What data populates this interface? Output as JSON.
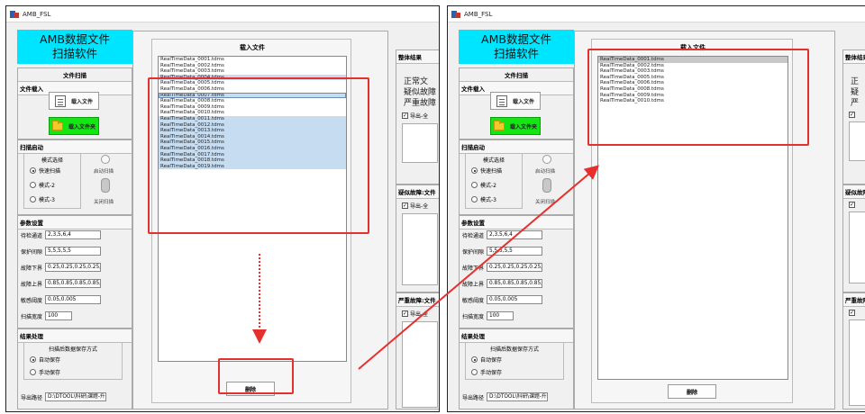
{
  "app": {
    "title": "AMB_FSL",
    "brand_line1": "AMB数据文件",
    "brand_line2": "扫描软件"
  },
  "file_scan": {
    "title": "文件扫描",
    "load_section": "文件载入",
    "load_file_button": "载入文件",
    "load_folder_button": "载入文件夹"
  },
  "scan_start": {
    "section": "扫描启动",
    "mode_group_title": "模式选择",
    "modes": [
      "快速扫描",
      "模式-2",
      "模式-3"
    ],
    "auto_label": "启动扫描",
    "stop_label": "关闭扫描"
  },
  "params": {
    "section": "参数设置",
    "rows": [
      {
        "label": "待检通道",
        "value": "2,3,5,6,4"
      },
      {
        "label": "保护间隙",
        "value": "5,5,5,5,5"
      },
      {
        "label": "故障下界",
        "value": "0.25,0.25,0.25,0.25,0.25"
      },
      {
        "label": "故障上界",
        "value": "0.85,0.85,0.85,0.85,0.85"
      },
      {
        "label": "敏感阈度",
        "value": "0.05,0.005"
      },
      {
        "label": "扫描宽度",
        "value": "100"
      }
    ]
  },
  "result_proc": {
    "section": "结果处理",
    "save_group_title": "扫描后数据保存方式",
    "save_modes": [
      "自动保存",
      "手动保存"
    ],
    "export_label": "导出路径",
    "export_path": "D:\\DTOOL\\科研\\课题-升"
  },
  "load_frame": {
    "title": "载入文件",
    "delete_button": "删除",
    "files_before": [
      "RealTimeData_0001.tdms",
      "RealTimeData_0002.tdms",
      "RealTimeData_0003.tdms",
      "RealTimeData_0004.tdms",
      "RealTimeData_0005.tdms",
      "RealTimeData_0006.tdms",
      "RealTimeData_0007.tdms",
      "RealTimeData_0008.tdms",
      "RealTimeData_0009.tdms",
      "RealTimeData_0010.tdms",
      "RealTimeData_0011.tdms",
      "RealTimeData_0012.tdms",
      "RealTimeData_0013.tdms",
      "RealTimeData_0014.tdms",
      "RealTimeData_0015.tdms",
      "RealTimeData_0016.tdms",
      "RealTimeData_0017.tdms",
      "RealTimeData_0018.tdms",
      "RealTimeData_0019.tdms"
    ],
    "files_after": [
      "RealTimeData_0001.tdms",
      "RealTimeData_0002.tdms",
      "RealTimeData_0003.tdms",
      "RealTimeData_0005.tdms",
      "RealTimeData_0006.tdms",
      "RealTimeData_0008.tdms",
      "RealTimeData_0009.tdms",
      "RealTimeData_0010.tdms"
    ]
  },
  "results": {
    "overall_title": "整体结果",
    "overall_lines": [
      "正常文",
      "疑似故障",
      "严重故障"
    ],
    "export_all": "导出-全",
    "suspect_title": "疑似故障:文件",
    "severe_title": "严重故障:文件",
    "right_overall_lines": [
      "正",
      "疑",
      "严"
    ]
  },
  "colors": {
    "brand": "#00e5ff",
    "green_button": "#14e614",
    "selection": "#c6dcf0",
    "annotation": "#e6302e"
  }
}
